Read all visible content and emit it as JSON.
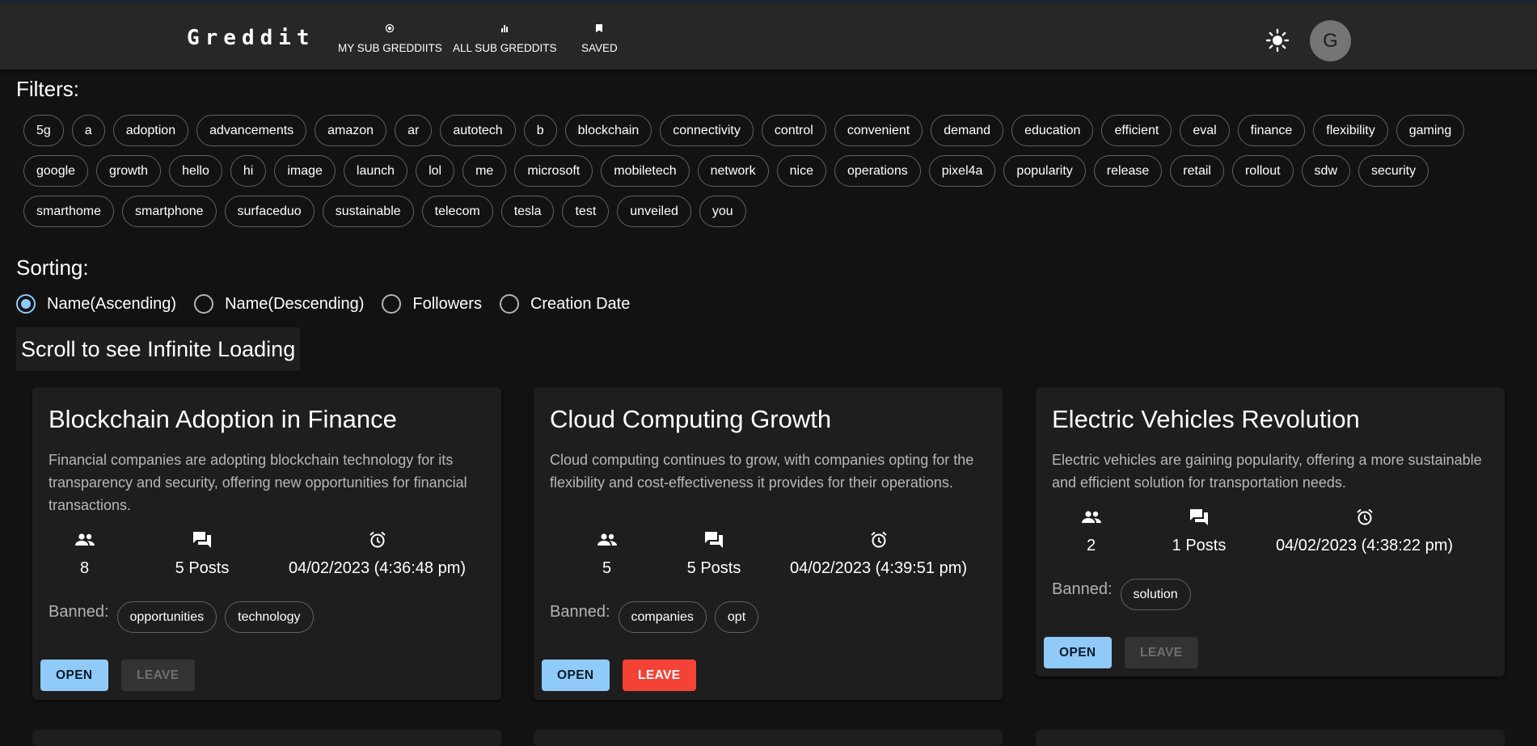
{
  "app": {
    "logo": "Greddit",
    "avatar_letter": "G"
  },
  "nav": [
    {
      "label": "MY SUB GREDDIITS",
      "icon": "radio-target-icon"
    },
    {
      "label": "ALL SUB GREDDITS",
      "icon": "bar-chart-icon"
    },
    {
      "label": "SAVED",
      "icon": "bookmark-icon"
    }
  ],
  "filters": {
    "title": "Filters:",
    "tags": [
      "5g",
      "a",
      "adoption",
      "advancements",
      "amazon",
      "ar",
      "autotech",
      "b",
      "blockchain",
      "connectivity",
      "control",
      "convenient",
      "demand",
      "education",
      "efficient",
      "eval",
      "finance",
      "flexibility",
      "gaming",
      "google",
      "growth",
      "hello",
      "hi",
      "image",
      "launch",
      "lol",
      "me",
      "microsoft",
      "mobiletech",
      "network",
      "nice",
      "operations",
      "pixel4a",
      "popularity",
      "release",
      "retail",
      "rollout",
      "sdw",
      "security",
      "smarthome",
      "smartphone",
      "surfaceduo",
      "sustainable",
      "telecom",
      "tesla",
      "test",
      "unveiled",
      "you"
    ]
  },
  "sorting": {
    "title": "Sorting:",
    "options": [
      "Name(Ascending)",
      "Name(Descending)",
      "Followers",
      "Creation Date"
    ],
    "selected": "Name(Ascending)"
  },
  "scroll_note": "Scroll to see Infinite Loading",
  "cards": [
    {
      "title": "Blockchain Adoption in Finance",
      "description": "Financial companies are adopting blockchain technology for its transparency and security, offering new opportunities for financial transactions.",
      "followers": "8",
      "posts": "5 Posts",
      "created": "04/02/2023 (4:36:48 pm)",
      "banned_label": "Banned:",
      "banned": [
        "opportunities",
        "technology"
      ],
      "open_label": "OPEN",
      "leave_label": "LEAVE",
      "leave_enabled": false
    },
    {
      "title": "Cloud Computing Growth",
      "description": "Cloud computing continues to grow, with companies opting for the flexibility and cost-effectiveness it provides for their operations.",
      "followers": "5",
      "posts": "5 Posts",
      "created": "04/02/2023 (4:39:51 pm)",
      "banned_label": "Banned:",
      "banned": [
        "companies",
        "opt"
      ],
      "open_label": "OPEN",
      "leave_label": "LEAVE",
      "leave_enabled": true
    },
    {
      "title": "Electric Vehicles Revolution",
      "description": "Electric vehicles are gaining popularity, offering a more sustainable and efficient solution for transportation needs.",
      "followers": "2",
      "posts": "1 Posts",
      "created": "04/02/2023 (4:38:22 pm)",
      "banned_label": "Banned:",
      "banned": [
        "solution"
      ],
      "open_label": "OPEN",
      "leave_label": "LEAVE",
      "leave_enabled": false
    }
  ],
  "colors": {
    "primary": "#90caf9",
    "danger": "#f44336",
    "background": "#121212",
    "surface": "#1e1e1e",
    "appbar": "#272727"
  }
}
